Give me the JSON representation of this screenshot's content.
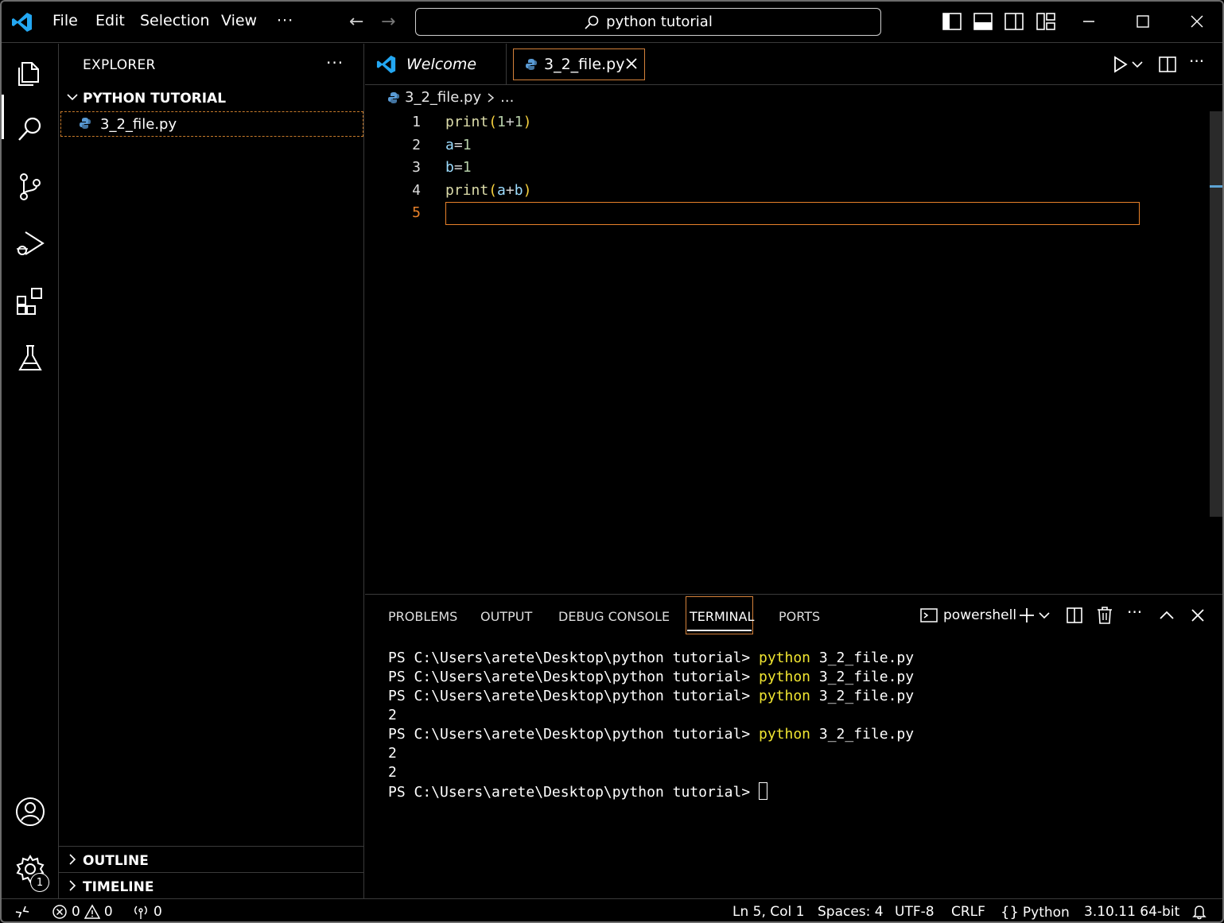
{
  "menu": [
    "File",
    "Edit",
    "Selection",
    "View"
  ],
  "search": {
    "text": "python tutorial"
  },
  "sidebar": {
    "title": "EXPLORER",
    "folder": "PYTHON TUTORIAL",
    "file": "3_2_file.py",
    "outline": "OUTLINE",
    "timeline": "TIMELINE"
  },
  "tabs": {
    "welcome": "Welcome",
    "file": "3_2_file.py"
  },
  "breadcrumb": {
    "file": "3_2_file.py",
    "more": "..."
  },
  "code": {
    "line_numbers": [
      "1",
      "2",
      "3",
      "4",
      "5"
    ],
    "lines": [
      [
        {
          "t": "print",
          "c": "#dcdcaa"
        },
        {
          "t": "(",
          "c": "#f7d23e"
        },
        {
          "t": "1",
          "c": "#b5cea8"
        },
        {
          "t": "+",
          "c": "#d4d4d4"
        },
        {
          "t": "1",
          "c": "#b5cea8"
        },
        {
          "t": ")",
          "c": "#f7d23e"
        }
      ],
      [
        {
          "t": "a",
          "c": "#9cdcfe"
        },
        {
          "t": "=",
          "c": "#d4d4d4"
        },
        {
          "t": "1",
          "c": "#b5cea8"
        }
      ],
      [
        {
          "t": "b",
          "c": "#9cdcfe"
        },
        {
          "t": "=",
          "c": "#d4d4d4"
        },
        {
          "t": "1",
          "c": "#b5cea8"
        }
      ],
      [
        {
          "t": "print",
          "c": "#dcdcaa"
        },
        {
          "t": "(",
          "c": "#f7d23e"
        },
        {
          "t": "a",
          "c": "#9cdcfe"
        },
        {
          "t": "+",
          "c": "#d4d4d4"
        },
        {
          "t": "b",
          "c": "#9cdcfe"
        },
        {
          "t": ")",
          "c": "#f7d23e"
        }
      ],
      []
    ]
  },
  "panel": {
    "tabs": [
      "PROBLEMS",
      "OUTPUT",
      "DEBUG CONSOLE",
      "TERMINAL",
      "PORTS"
    ],
    "active_tab": "TERMINAL",
    "terminal_name": "powershell"
  },
  "terminal": {
    "lines": [
      {
        "prompt": "PS C:\\Users\\arete\\Desktop\\python tutorial> ",
        "cmd": "python",
        "arg": " 3_2_file.py"
      },
      {
        "prompt": "PS C:\\Users\\arete\\Desktop\\python tutorial> ",
        "cmd": "python",
        "arg": " 3_2_file.py"
      },
      {
        "prompt": "PS C:\\Users\\arete\\Desktop\\python tutorial> ",
        "cmd": "python",
        "arg": " 3_2_file.py"
      },
      {
        "out": "2"
      },
      {
        "prompt": "PS C:\\Users\\arete\\Desktop\\python tutorial> ",
        "cmd": "python",
        "arg": " 3_2_file.py"
      },
      {
        "out": "2"
      },
      {
        "out": "2"
      },
      {
        "prompt": "PS C:\\Users\\arete\\Desktop\\python tutorial> ",
        "cursor": true
      }
    ]
  },
  "status": {
    "errors": "0",
    "warnings": "0",
    "ports": "0",
    "position": "Ln 5, Col 1",
    "spaces": "Spaces: 4",
    "encoding": "UTF-8",
    "eol": "CRLF",
    "language": "Python",
    "interpreter": "3.10.11 64-bit"
  },
  "accounts_badge": "1",
  "colors": {
    "accent": "#e8812a",
    "command": "#f0e531",
    "vscode_blue": "#23a7f2"
  }
}
